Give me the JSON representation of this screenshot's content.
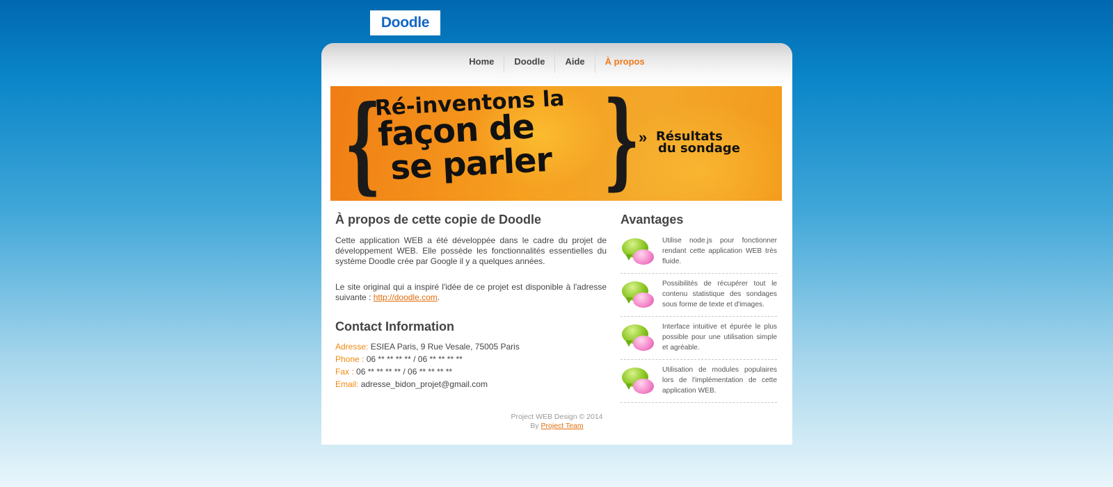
{
  "logo": {
    "text": "Doodle"
  },
  "nav": {
    "items": [
      {
        "label": "Home"
      },
      {
        "label": "Doodle"
      },
      {
        "label": "Aide"
      },
      {
        "label": "À propos"
      }
    ],
    "active_index": 3
  },
  "banner": {
    "line1": "Ré-inventons la",
    "line2": "façon de",
    "line3": "se parler",
    "results_line1": "Résultats",
    "results_line2": "du sondage",
    "arrow_glyph": "»"
  },
  "about": {
    "title": "À propos de cette copie de Doodle",
    "paragraph1": "Cette application WEB a été développée dans le cadre du projet de développement WEB. Elle possède les fonctionnalités essentielles du système Doodle crée par Google il y a quelques années.",
    "paragraph2_prefix": "Le site original qui a inspiré l'idée de ce projet est disponible à l'adresse suivante : ",
    "paragraph2_link": "http://doodle.com",
    "paragraph2_suffix": "."
  },
  "contact": {
    "title": "Contact Information",
    "address_label": "Adresse:",
    "address_value": "ESIEA Paris, 9 Rue Vesale, 75005 Paris",
    "phone_label": "Phone :",
    "phone_value": "06 ** ** ** ** / 06 ** ** ** **",
    "fax_label": "Fax :",
    "fax_value": "06 ** ** ** ** / 06 ** ** ** **",
    "email_label": "Email:",
    "email_value": "adresse_bidon_projet@gmail.com"
  },
  "advantages": {
    "title": "Avantages",
    "items": [
      {
        "text": "Utilise node.js pour fonctionner rendant cette application WEB très fluide.",
        "icon": "chat-bubbles-icon"
      },
      {
        "text": "Possibilités de récupérer tout le contenu statistique des sondages sous forme de texte et d'images.",
        "icon": "chat-bubbles-icon"
      },
      {
        "text": "Interface intuitive et épurée le plus possible pour une utilisation simple et agréable.",
        "icon": "chat-bubbles-icon"
      },
      {
        "text": "Utilisation de modules populaires lors de l'implémentation de cette application WEB.",
        "icon": "chat-bubbles-icon"
      }
    ]
  },
  "footer": {
    "line1": "Project WEB Design © 2014",
    "by_prefix": "By ",
    "by_link": "Project Team"
  },
  "colors": {
    "accent_orange": "#f07a1a",
    "link_orange": "#e06d0a",
    "text_gray": "#444444",
    "logo_blue": "#1266c4"
  }
}
